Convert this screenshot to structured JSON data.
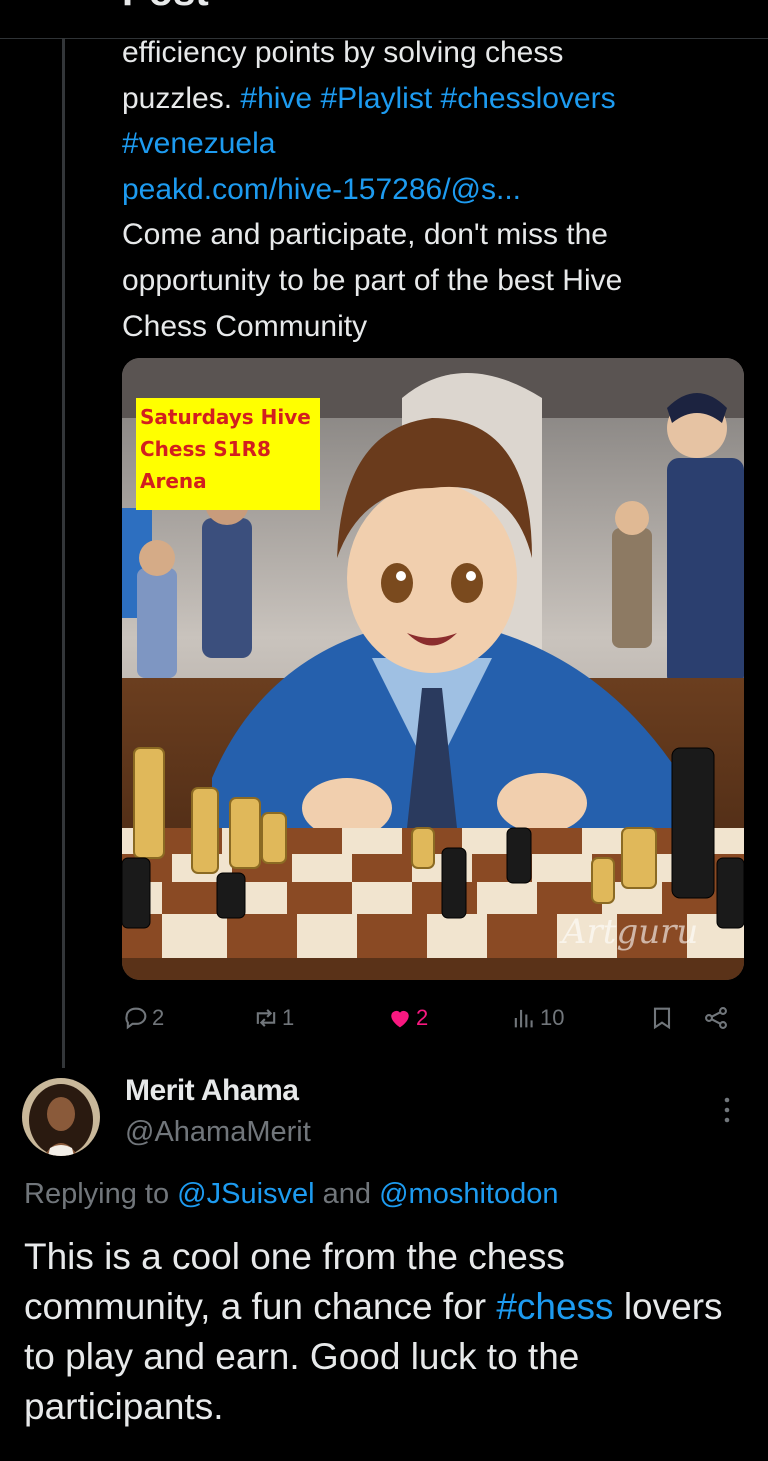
{
  "header": {
    "title": "Post"
  },
  "post": {
    "lines": {
      "l1": "efficiency points by solving chess",
      "l2a": "puzzles. ",
      "h1": "#hive",
      "h2": "#Playlist",
      "h3": "#chesslovers",
      "h4": "#venezuela",
      "url": "peakd.com/hive-157286/@s...",
      "l3": "Come and participate, don't miss the",
      "l4": "opportunity to be part of the best Hive",
      "l5": "Chess Community"
    },
    "image": {
      "banner_line1": "Saturdays Hive",
      "banner_line2": "Chess S1R8",
      "banner_line3": "Arena",
      "watermark": "Artguru"
    },
    "actions": {
      "replies": "2",
      "reposts": "1",
      "likes": "2",
      "views": "10"
    },
    "colors": {
      "link": "#1d9bf0",
      "like": "#f91880",
      "muted": "#71767b"
    }
  },
  "reply": {
    "name": "Merit Ahama",
    "handle": "@AhamaMerit",
    "replying_prefix": "Replying to ",
    "mention1": "@JSuisvel",
    "replying_and": " and ",
    "mention2": "@moshitodon",
    "text_a": "This is a cool one from the chess community, a fun chance for ",
    "hashtag": "#chess",
    "text_b": " lovers to play and earn. Good luck to the participants."
  }
}
